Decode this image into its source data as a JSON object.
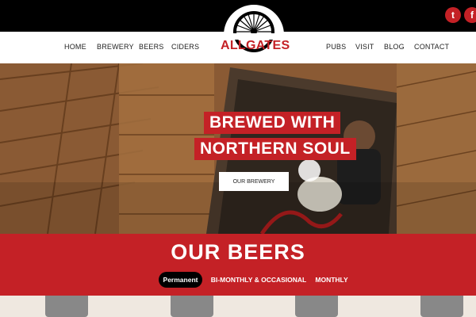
{
  "brand": {
    "name": "ALLGATES",
    "accent": "#c42126"
  },
  "social": [
    {
      "name": "twitter-icon",
      "glyph": "t"
    },
    {
      "name": "facebook-icon",
      "glyph": "f"
    }
  ],
  "nav": {
    "left": [
      "HOME",
      "BREWERY",
      "BEERS",
      "CIDERS"
    ],
    "right": [
      "PUBS",
      "VISIT",
      "BLOG",
      "CONTACT"
    ]
  },
  "hero": {
    "line1": "BREWED WITH",
    "line2": "NORTHERN SOUL",
    "button": "Our Brewery"
  },
  "beers": {
    "title": "OUR BEERS",
    "tabs": [
      {
        "label": "Permanent",
        "active": true
      },
      {
        "label": "Bi-Monthly & Occasional",
        "active": false
      },
      {
        "label": "Monthly",
        "active": false
      }
    ]
  }
}
